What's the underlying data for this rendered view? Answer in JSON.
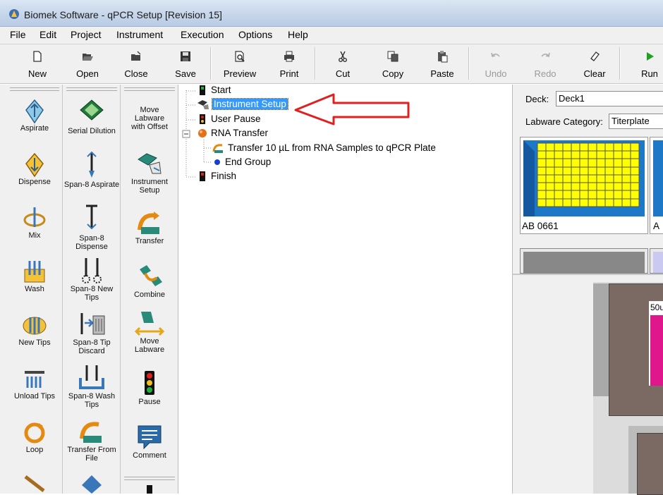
{
  "window": {
    "title": "Biomek Software - qPCR Setup [Revision 15]"
  },
  "menu": [
    "File",
    "Edit",
    "Project",
    "Instrument",
    "Execution",
    "Options",
    "Help"
  ],
  "toolbar": [
    {
      "label": "New",
      "icon": "new-file-icon",
      "enabled": true
    },
    {
      "label": "Open",
      "icon": "open-folder-icon",
      "enabled": true
    },
    {
      "label": "Close",
      "icon": "close-folder-icon",
      "enabled": true
    },
    {
      "label": "Save",
      "icon": "save-disk-icon",
      "enabled": true
    },
    {
      "label": "Preview",
      "icon": "print-preview-icon",
      "enabled": true
    },
    {
      "label": "Print",
      "icon": "printer-icon",
      "enabled": true
    },
    {
      "label": "Cut",
      "icon": "scissors-icon",
      "enabled": true
    },
    {
      "label": "Copy",
      "icon": "copy-icon",
      "enabled": true
    },
    {
      "label": "Paste",
      "icon": "paste-icon",
      "enabled": true
    },
    {
      "label": "Undo",
      "icon": "undo-icon",
      "enabled": false
    },
    {
      "label": "Redo",
      "icon": "redo-icon",
      "enabled": false
    },
    {
      "label": "Clear",
      "icon": "eraser-icon",
      "enabled": true
    },
    {
      "label": "Run",
      "icon": "run-play-icon",
      "enabled": true
    }
  ],
  "palette": {
    "col1": [
      "Aspirate",
      "Dispense",
      "Mix",
      "Wash",
      "New Tips",
      "Unload Tips",
      "Loop"
    ],
    "col2": [
      "Serial Dilution",
      "Span-8 Aspirate",
      "Span-8 Dispense",
      "Span-8 New Tips",
      "Span-8 Tip Discard",
      "Span-8 Wash Tips",
      "Transfer From File"
    ],
    "col3": [
      "Move Labware with Offset",
      "Instrument Setup",
      "Transfer",
      "Combine",
      "Move Labware",
      "Pause",
      "Comment"
    ]
  },
  "tree": {
    "nodes": [
      {
        "label": "Start",
        "icon": "start-flag-icon"
      },
      {
        "label": "Instrument Setup",
        "icon": "instrument-setup-icon",
        "selected": true
      },
      {
        "label": "User Pause",
        "icon": "pause-light-icon"
      },
      {
        "label": "RNA Transfer",
        "icon": "group-orange-dot-icon",
        "expander": "−"
      },
      {
        "label": "Transfer 10 µL from RNA Samples to qPCR Plate",
        "icon": "transfer-icon"
      },
      {
        "label": "End Group",
        "icon": "end-group-blue-dot-icon"
      },
      {
        "label": "Finish",
        "icon": "finish-flag-icon"
      }
    ]
  },
  "deck": {
    "deck_label": "Deck:",
    "deck_value": "Deck1",
    "category_label": "Labware Category:",
    "category_value": "Titerplate",
    "labware_name": "AB 0661",
    "labware_name_2": "A",
    "volume_label": "50u"
  },
  "colors": {
    "selection": "#3399ff",
    "arrow": "#e02020",
    "plate_frame": "#1e78c8",
    "plate_wells": "#ffff00",
    "deck_brown": "#7b6a64",
    "magenta": "#e0168c"
  }
}
